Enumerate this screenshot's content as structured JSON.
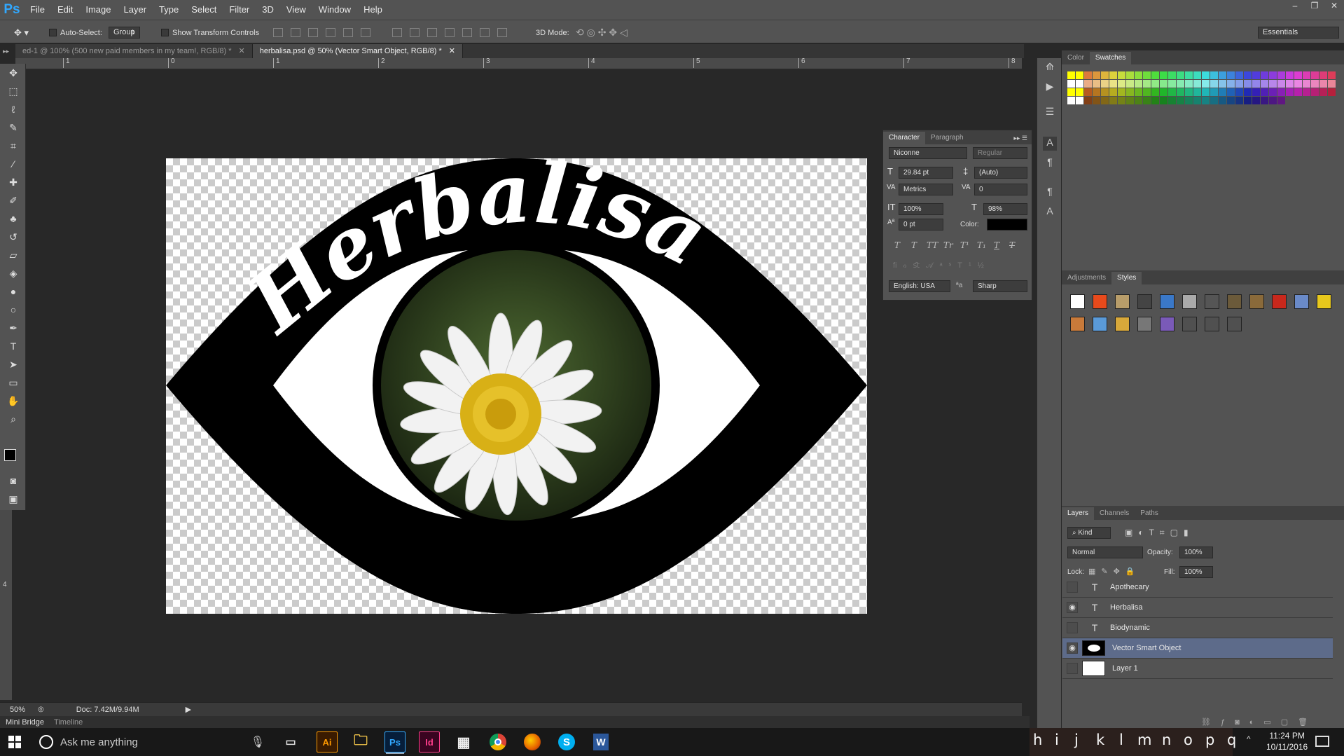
{
  "app": {
    "name": "Ps"
  },
  "menu": [
    "File",
    "Edit",
    "Image",
    "Layer",
    "Type",
    "Select",
    "Filter",
    "3D",
    "View",
    "Window",
    "Help"
  ],
  "window_controls": {
    "minimize": "–",
    "restore": "❐",
    "close": "✕"
  },
  "options": {
    "auto_select": "Auto-Select:",
    "auto_select_value": "Group",
    "transform": "Show Transform Controls",
    "mode3d": "3D Mode:",
    "workspace": "Essentials"
  },
  "tabs": [
    {
      "label": "ed-1 @ 100% (500 new paid members in my team!, RGB/8) *",
      "close": "✕"
    },
    {
      "label": "herbalisa.psd @ 50% (Vector Smart Object, RGB/8) *",
      "close": "✕"
    }
  ],
  "ruler": {
    "marks": [
      "1",
      "0",
      "1",
      "2",
      "3",
      "4",
      "5",
      "6",
      "7",
      "8"
    ]
  },
  "ruler_left": {
    "marks": [
      "4"
    ]
  },
  "canvas_art": {
    "text": "Herbalisa"
  },
  "character": {
    "tabs": [
      "Character",
      "Paragraph"
    ],
    "font": "Niconne",
    "style": "Regular",
    "size": "29.84 pt",
    "leading": "(Auto)",
    "kerning": "Metrics",
    "tracking": "0",
    "vscale": "100%",
    "hscale": "98%",
    "baseline": "0 pt",
    "color_label": "Color:",
    "language": "English: USA",
    "aa_label": "a",
    "antialias": "Sharp",
    "type_styles": [
      "T",
      "T",
      "TT",
      "Tr",
      "T¹",
      "T₁",
      "T",
      "T"
    ]
  },
  "color_panel": {
    "tabs": [
      "Color",
      "Swatches"
    ]
  },
  "styles_panel": {
    "tabs": [
      "Adjustments",
      "Styles"
    ]
  },
  "layers_panel": {
    "tabs": [
      "Layers",
      "Channels",
      "Paths"
    ],
    "kind": "Kind",
    "blend": "Normal",
    "opacity_label": "Opacity:",
    "opacity": "100%",
    "lock_label": "Lock:",
    "fill_label": "Fill:",
    "fill": "100%",
    "layers": [
      {
        "name": "Apothecary",
        "visible": false,
        "type": "T"
      },
      {
        "name": "Herbalisa",
        "visible": true,
        "type": "T"
      },
      {
        "name": "Biodynamic",
        "visible": false,
        "type": "T"
      },
      {
        "name": "Vector Smart Object",
        "visible": true,
        "type": "smart",
        "selected": true
      },
      {
        "name": "Layer 1",
        "visible": false,
        "type": "pixel"
      }
    ]
  },
  "status": {
    "zoom": "50%",
    "doc": "Doc: 7.42M/9.94M"
  },
  "bottom_tabs": [
    "Mini Bridge",
    "Timeline"
  ],
  "taskbar": {
    "search_placeholder": "Ask me anything",
    "apps": [
      "Ai",
      "Ps",
      "Id"
    ],
    "time": "11:24 PM",
    "date": "10/11/2016",
    "keys": [
      "h",
      "i",
      "j",
      "k",
      "l",
      "m",
      "n",
      "o",
      "p",
      "q"
    ]
  },
  "colors": {
    "accent": "#31a8ff",
    "selection": "#5d6b8a",
    "panel": "#535353",
    "bg": "#282828"
  }
}
